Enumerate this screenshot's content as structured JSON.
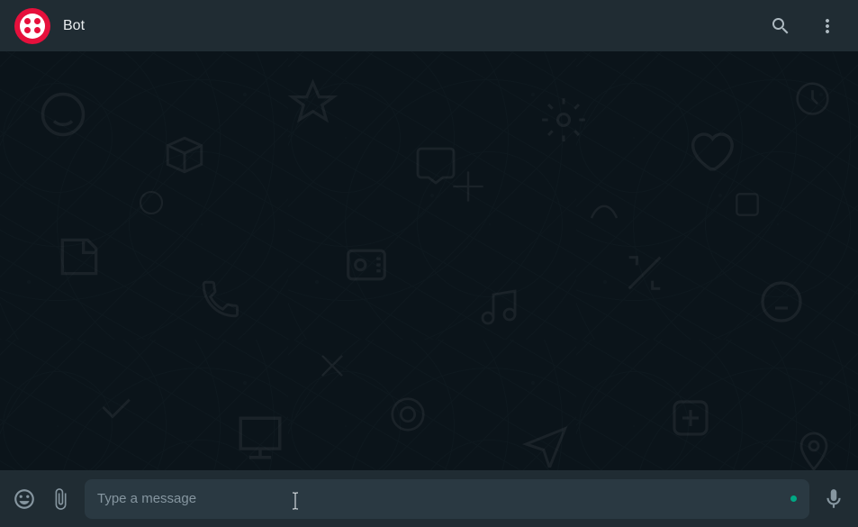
{
  "header": {
    "chat_title": "Bot",
    "avatar_color": "#e6103c",
    "icons": {
      "search": "search-icon",
      "menu": "menu-icon"
    }
  },
  "composer": {
    "placeholder": "Type a message",
    "value": "",
    "status_indicator_color": "#00a884",
    "icons": {
      "emoji": "emoji-icon",
      "attach": "attach-icon",
      "mic": "mic-icon"
    }
  },
  "theme": {
    "header_bg": "#202c33",
    "body_bg": "#0b141a",
    "footer_bg": "#202c33",
    "input_bg": "#2a3942",
    "icon_color": "#8696a0",
    "header_icon_color": "#aebac1",
    "title_color": "#e9edef"
  }
}
